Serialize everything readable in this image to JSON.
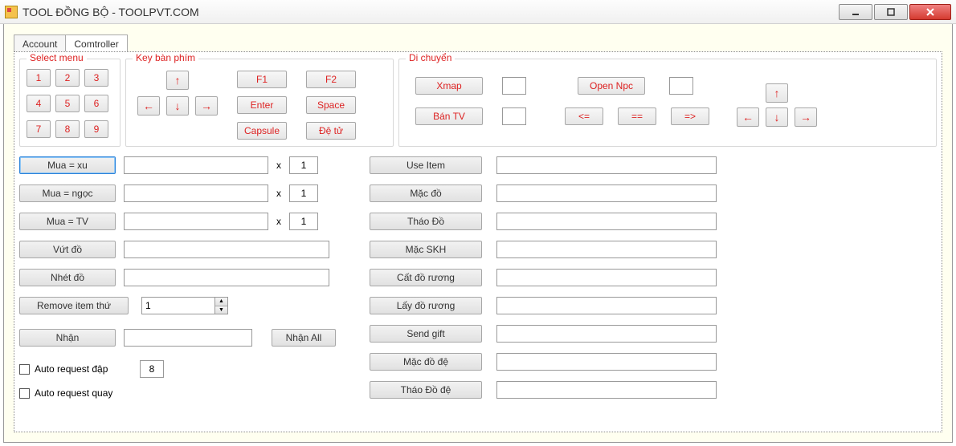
{
  "window": {
    "title": "TOOL ĐỒNG BỘ - TOOLPVT.COM"
  },
  "tabs": {
    "account": "Account",
    "comtroller": "Comtroller"
  },
  "groups": {
    "select_menu": "Select menu",
    "key_ban_phim": "Key bàn phím",
    "di_chuyen": "Di chuyển"
  },
  "menu_numbers": [
    "1",
    "2",
    "3",
    "4",
    "5",
    "6",
    "7",
    "8",
    "9"
  ],
  "keys": {
    "up": "↑",
    "down": "↓",
    "left": "←",
    "right": "→",
    "f1": "F1",
    "f2": "F2",
    "enter": "Enter",
    "space": "Space",
    "capsule": "Capsule",
    "detu": "Đệ tử"
  },
  "move": {
    "xmap": "Xmap",
    "open_npc": "Open Npc",
    "ban_tv": "Bán TV",
    "lte": "<=",
    "eq": "==",
    "gte": "=>",
    "xmap_val": "",
    "open_npc_val": "",
    "ban_tv_val": "",
    "left": "←",
    "down": "↓",
    "right": "→",
    "up": "↑"
  },
  "left_actions": {
    "mua_xu": "Mua  = xu",
    "mua_xu_item": "",
    "mua_xu_qty": "1",
    "mua_ngoc": "Mua  = ngọc",
    "mua_ngoc_item": "",
    "mua_ngoc_qty": "1",
    "mua_tv": "Mua  = TV",
    "mua_tv_item": "",
    "mua_tv_qty": "1",
    "vut_do": "Vứt đồ",
    "vut_do_val": "",
    "nhet_do": "Nhét đồ",
    "nhet_do_val": "",
    "remove_item": "Remove item thứ",
    "remove_item_val": "1",
    "nhan": "Nhận",
    "nhan_val": "",
    "nhan_all": "Nhận All",
    "x_label": "x"
  },
  "right_actions": {
    "use_item": "Use Item",
    "use_item_val": "",
    "mac_do": "Mặc đồ",
    "mac_do_val": "",
    "thao_do": "Tháo Đồ",
    "thao_do_val": "",
    "mac_skh": "Mặc SKH",
    "mac_skh_val": "",
    "cat_do_ruong": "Cất đồ rương",
    "cat_do_ruong_val": "",
    "lay_do_ruong": "Lấy đồ rương",
    "lay_do_ruong_val": "",
    "send_gift": "Send gift",
    "send_gift_val": "",
    "mac_do_de": "Mặc đồ đệ",
    "mac_do_de_val": "",
    "thao_do_de": "Tháo Đồ đệ",
    "thao_do_de_val": ""
  },
  "auto": {
    "request_dap": "Auto request đập",
    "request_dap_val": "8",
    "request_quay": "Auto request quay"
  }
}
